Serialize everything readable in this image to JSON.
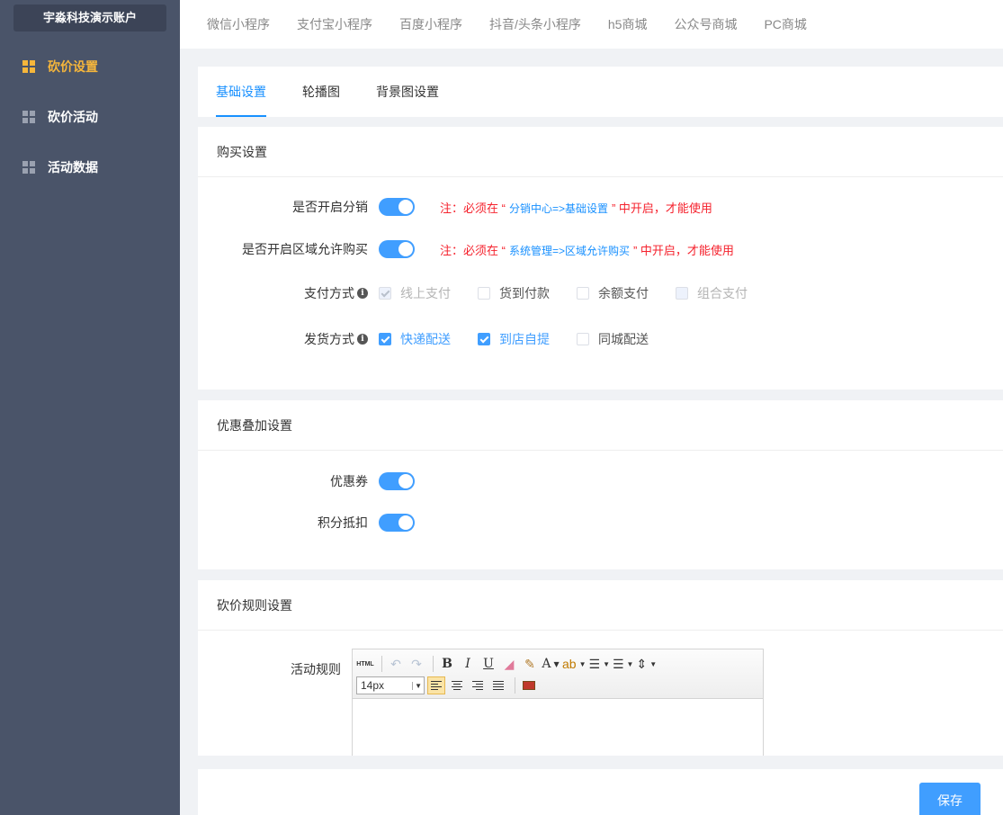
{
  "sidebar": {
    "account": "宇淼科技演示账户",
    "items": [
      {
        "label": "砍价设置",
        "active": true
      },
      {
        "label": "砍价活动"
      },
      {
        "label": "活动数据"
      }
    ]
  },
  "top_tabs": [
    "微信小程序",
    "支付宝小程序",
    "百度小程序",
    "抖音/头条小程序",
    "h5商城",
    "公众号商城",
    "PC商城"
  ],
  "sub_tabs": [
    {
      "label": "基础设置",
      "active": true
    },
    {
      "label": "轮播图"
    },
    {
      "label": "背景图设置"
    }
  ],
  "purchase": {
    "title": "购买设置",
    "distribution": {
      "label": "是否开启分销",
      "enabled": true,
      "note_pre": "注：必须在 “",
      "note_link": "分销中心=>基础设置",
      "note_post": "” 中开启，才能使用"
    },
    "region": {
      "label": "是否开启区域允许购买",
      "enabled": true,
      "note_pre": "注：必须在 “",
      "note_link": "系统管理=>区域允许购买",
      "note_post": "” 中开启，才能使用"
    },
    "payment": {
      "label": "支付方式",
      "info_icon": "i",
      "options": [
        {
          "label": "线上支付",
          "state": "disabled-checked"
        },
        {
          "label": "货到付款",
          "state": "unchecked"
        },
        {
          "label": "余额支付",
          "state": "unchecked"
        },
        {
          "label": "组合支付",
          "state": "disabled"
        }
      ]
    },
    "shipping": {
      "label": "发货方式",
      "info_icon": "i",
      "options": [
        {
          "label": "快递配送",
          "state": "checked"
        },
        {
          "label": "到店自提",
          "state": "checked"
        },
        {
          "label": "同城配送",
          "state": "unchecked"
        }
      ]
    }
  },
  "discount": {
    "title": "优惠叠加设置",
    "coupon": {
      "label": "优惠券",
      "enabled": true
    },
    "points": {
      "label": "积分抵扣",
      "enabled": true
    }
  },
  "rules": {
    "title": "砍价规则设置",
    "label": "活动规则",
    "editor": {
      "html_btn": "HTML",
      "bold": "B",
      "italic": "I",
      "underline": "U",
      "font_color": "A",
      "font_size": "14px"
    }
  },
  "footer": {
    "save_label": "保存"
  },
  "colors": {
    "sidebar": "#4a5469",
    "accent": "#409eff",
    "active_nav": "#f6b63b",
    "warning": "#f5222d"
  }
}
